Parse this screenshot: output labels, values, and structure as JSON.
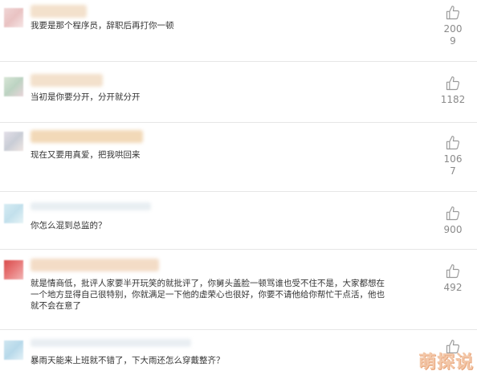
{
  "comments": [
    {
      "text": "我要是那个程序员，辞职后再打你一顿",
      "likes": "200\n9"
    },
    {
      "text": "当初是你要分开，分开就分开",
      "likes": "1182"
    },
    {
      "text": "现在又要用真爱，把我哄回来",
      "likes": "106\n7"
    },
    {
      "text": "你怎么混到总监的？",
      "likes": "900"
    },
    {
      "text": "就是情商低，批评人家要半开玩笑的就批评了，你舅头盖脸一顿骂谁也受不住不是，大家都想在\n一个地方显得自己很特别，你就满足一下他的虚荣心也很好，你要不请他给你帮忙干点活，他也\n就不会在意了",
      "likes": "492"
    },
    {
      "text": "暴雨天能来上班就不错了，下大雨还怎么穿戴整齐？",
      "likes": ""
    }
  ],
  "like_icon": "thumbs-up-icon",
  "watermark": "萌探说"
}
